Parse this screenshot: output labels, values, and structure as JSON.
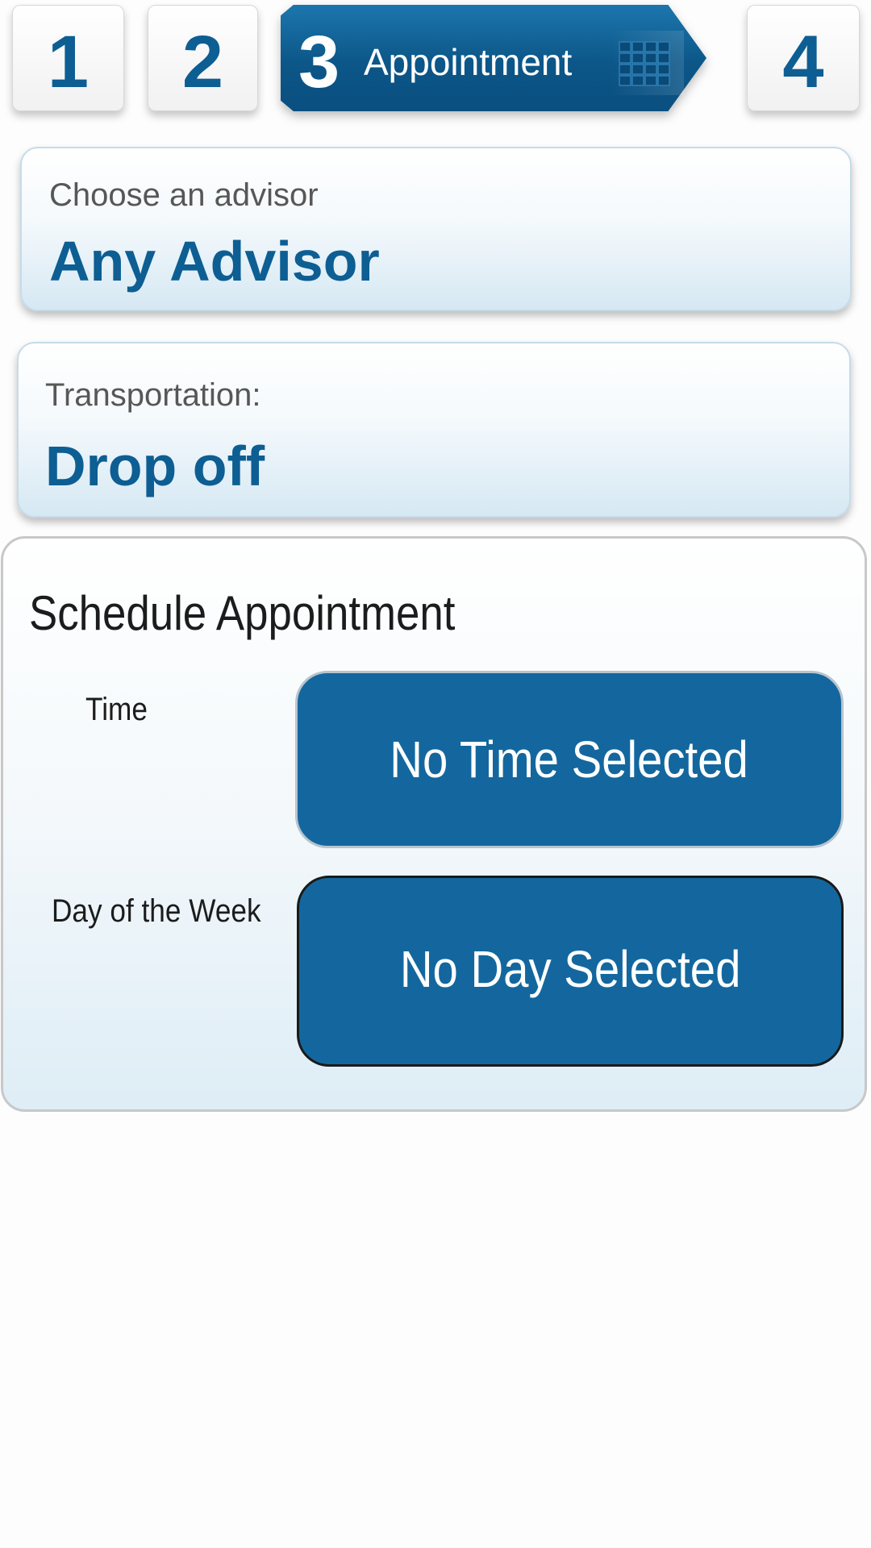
{
  "steps": {
    "step1": "1",
    "step2": "2",
    "step3_number": "3",
    "step3_label": "Appointment",
    "step4": "4",
    "active_step": 3
  },
  "advisor": {
    "label": "Choose an advisor",
    "value": "Any Advisor"
  },
  "transportation": {
    "label": "Transportation:",
    "value": "Drop off"
  },
  "schedule": {
    "title": "Schedule Appointment",
    "time_label": "Time",
    "time_value": "No Time Selected",
    "day_label": "Day of the Week",
    "day_value": "No Day Selected"
  },
  "colors": {
    "brand_blue": "#0d5e93",
    "button_blue": "#13679e"
  }
}
